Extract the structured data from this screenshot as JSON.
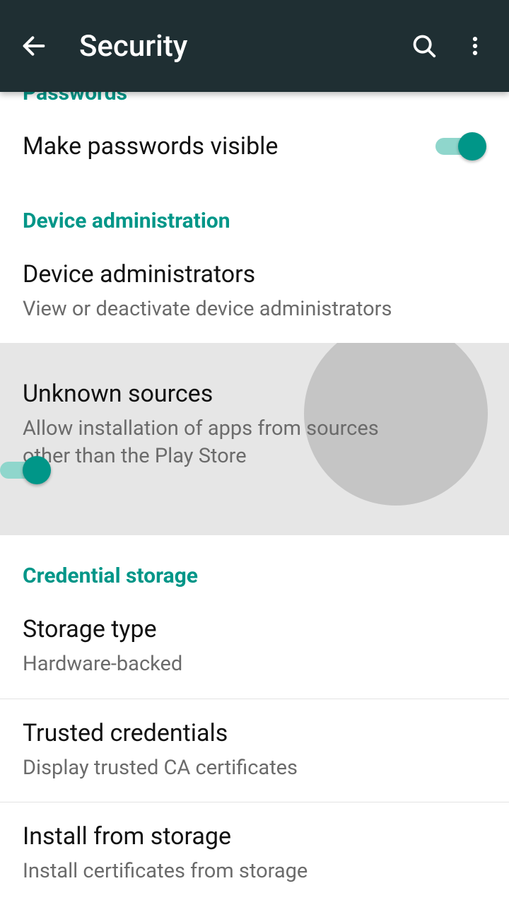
{
  "appbar": {
    "title": "Security"
  },
  "sections": {
    "passwords": {
      "header": "Passwords",
      "make_visible": {
        "title": "Make passwords visible"
      }
    },
    "device_admin": {
      "header": "Device administration",
      "administrators": {
        "title": "Device administrators",
        "sub": "View or deactivate device administrators"
      },
      "unknown_sources": {
        "title": "Unknown sources",
        "sub": "Allow installation of apps from sources other than the Play Store"
      }
    },
    "credential_storage": {
      "header": "Credential storage",
      "storage_type": {
        "title": "Storage type",
        "sub": "Hardware-backed"
      },
      "trusted": {
        "title": "Trusted credentials",
        "sub": "Display trusted CA certificates"
      },
      "install": {
        "title": "Install from storage",
        "sub": "Install certificates from storage"
      }
    }
  }
}
